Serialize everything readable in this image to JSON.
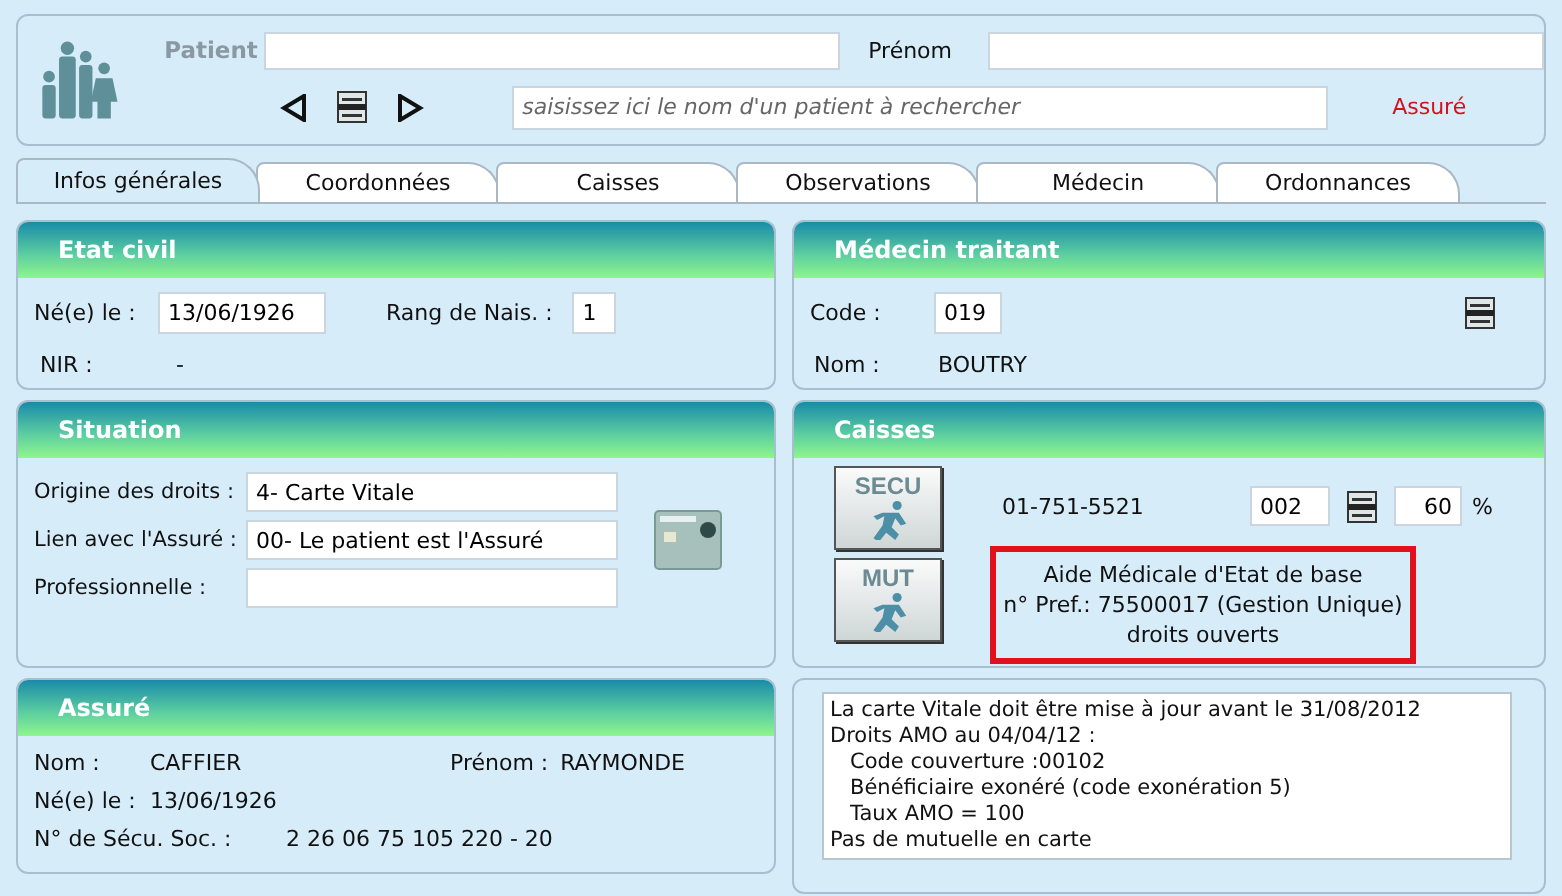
{
  "header": {
    "patient_label": "Patient",
    "prenom_label": "Prénom",
    "search": {
      "placeholder": "saisissez ici le nom d'un patient à rechercher"
    },
    "assure_link": "Assuré"
  },
  "tabs": [
    {
      "label": "Infos générales",
      "selected": true
    },
    {
      "label": "Coordonnées",
      "selected": false
    },
    {
      "label": "Caisses",
      "selected": false
    },
    {
      "label": "Observations",
      "selected": false
    },
    {
      "label": "Médecin",
      "selected": false
    },
    {
      "label": "Ordonnances",
      "selected": false
    }
  ],
  "etat_civil": {
    "title": "Etat civil",
    "birth_label": "Né(e) le :",
    "birth_value": "13/06/1926",
    "rank_label": "Rang de Nais. :",
    "rank_value": "1",
    "nir_label": "NIR :",
    "nir_value": "-"
  },
  "situation": {
    "title": "Situation",
    "fields": [
      {
        "label": "Origine des droits :",
        "value": "4- Carte Vitale"
      },
      {
        "label": "Lien avec l'Assuré :",
        "value": "00- Le patient est l'Assuré"
      },
      {
        "label": "Professionnelle :"
      }
    ]
  },
  "assure": {
    "title": "Assuré",
    "nom_label": "Nom :",
    "nom_value": "CAFFIER",
    "prenom_label": "Prénom :",
    "prenom_value": "RAYMONDE",
    "birth_label": "Né(e) le :",
    "birth_value": "13/06/1926",
    "secu_label": "N° de Sécu. Soc. :",
    "secu_value": "2 26 06 75 105 220 - 20"
  },
  "medecin": {
    "title": "Médecin traitant",
    "code_label": "Code :",
    "code_value": "019",
    "nom_label": "Nom :",
    "nom_value": "BOUTRY"
  },
  "caisses": {
    "title": "Caisses",
    "secu_button": "SECU",
    "mut_button": "MUT",
    "number": "01-751-5521",
    "code_value": "002",
    "rate_value": "60",
    "rate_unit": "%",
    "info_lines": [
      "Aide Médicale d'Etat de base",
      "n° Pref.: 75500017 (Gestion Unique)",
      "droits ouverts"
    ]
  },
  "memo": {
    "lines": [
      "La carte Vitale doit être mise à jour avant le 31/08/2012",
      "Droits AMO au 04/04/12 :",
      "   Code couverture :00102",
      "   Bénéficiaire exonéré (code exonération 5)",
      "   Taux AMO = 100",
      "Pas de mutuelle en carte"
    ]
  }
}
